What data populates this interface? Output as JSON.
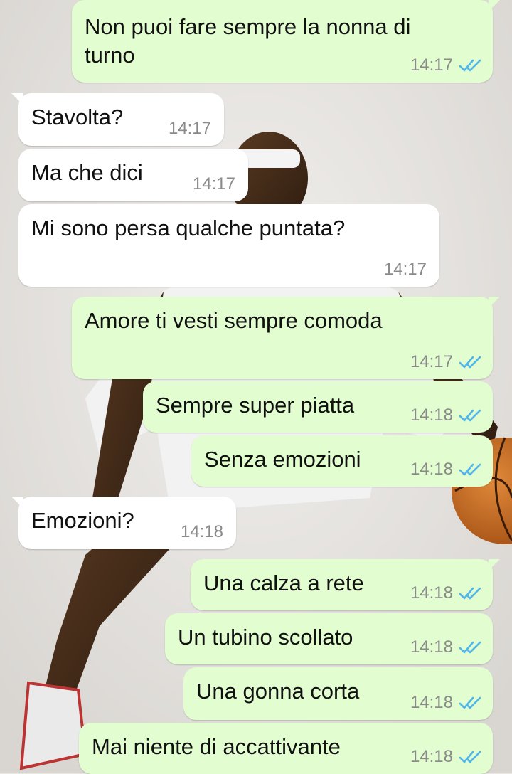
{
  "messages": [
    {
      "dir": "out",
      "text": "Non puoi fare sempre la nonna di\nturno",
      "time": "14:17",
      "status": "read-ticks-icon"
    },
    {
      "dir": "in",
      "text": "Stavolta?",
      "time": "14:17"
    },
    {
      "dir": "in",
      "text": "Ma che dici",
      "time": "14:17"
    },
    {
      "dir": "in",
      "text": "Mi sono persa qualche puntata?",
      "time": "14:17"
    },
    {
      "dir": "out",
      "text": "Amore ti vesti sempre comoda",
      "time": "14:17",
      "status": "read-ticks-icon"
    },
    {
      "dir": "out",
      "text": "Sempre super piatta",
      "time": "14:18",
      "status": "read-ticks-icon"
    },
    {
      "dir": "out",
      "text": "Senza emozioni",
      "time": "14:18",
      "status": "read-ticks-icon"
    },
    {
      "dir": "in",
      "text": "Emozioni?",
      "time": "14:18"
    },
    {
      "dir": "out",
      "text": "Una calza a rete",
      "time": "14:18",
      "status": "read-ticks-icon"
    },
    {
      "dir": "out",
      "text": "Un tubino scollato",
      "time": "14:18",
      "status": "read-ticks-icon"
    },
    {
      "dir": "out",
      "text": "Una gonna corta",
      "time": "14:18",
      "status": "read-ticks-icon"
    },
    {
      "dir": "out",
      "text": "Mai niente di accattivante",
      "time": "14:18",
      "status": "read-ticks-icon"
    }
  ],
  "colors": {
    "incoming_bubble": "#ffffff",
    "outgoing_bubble": "#e2fdcf",
    "read_ticks": "#4fb6ec",
    "timestamp": "#8a8a8a"
  }
}
